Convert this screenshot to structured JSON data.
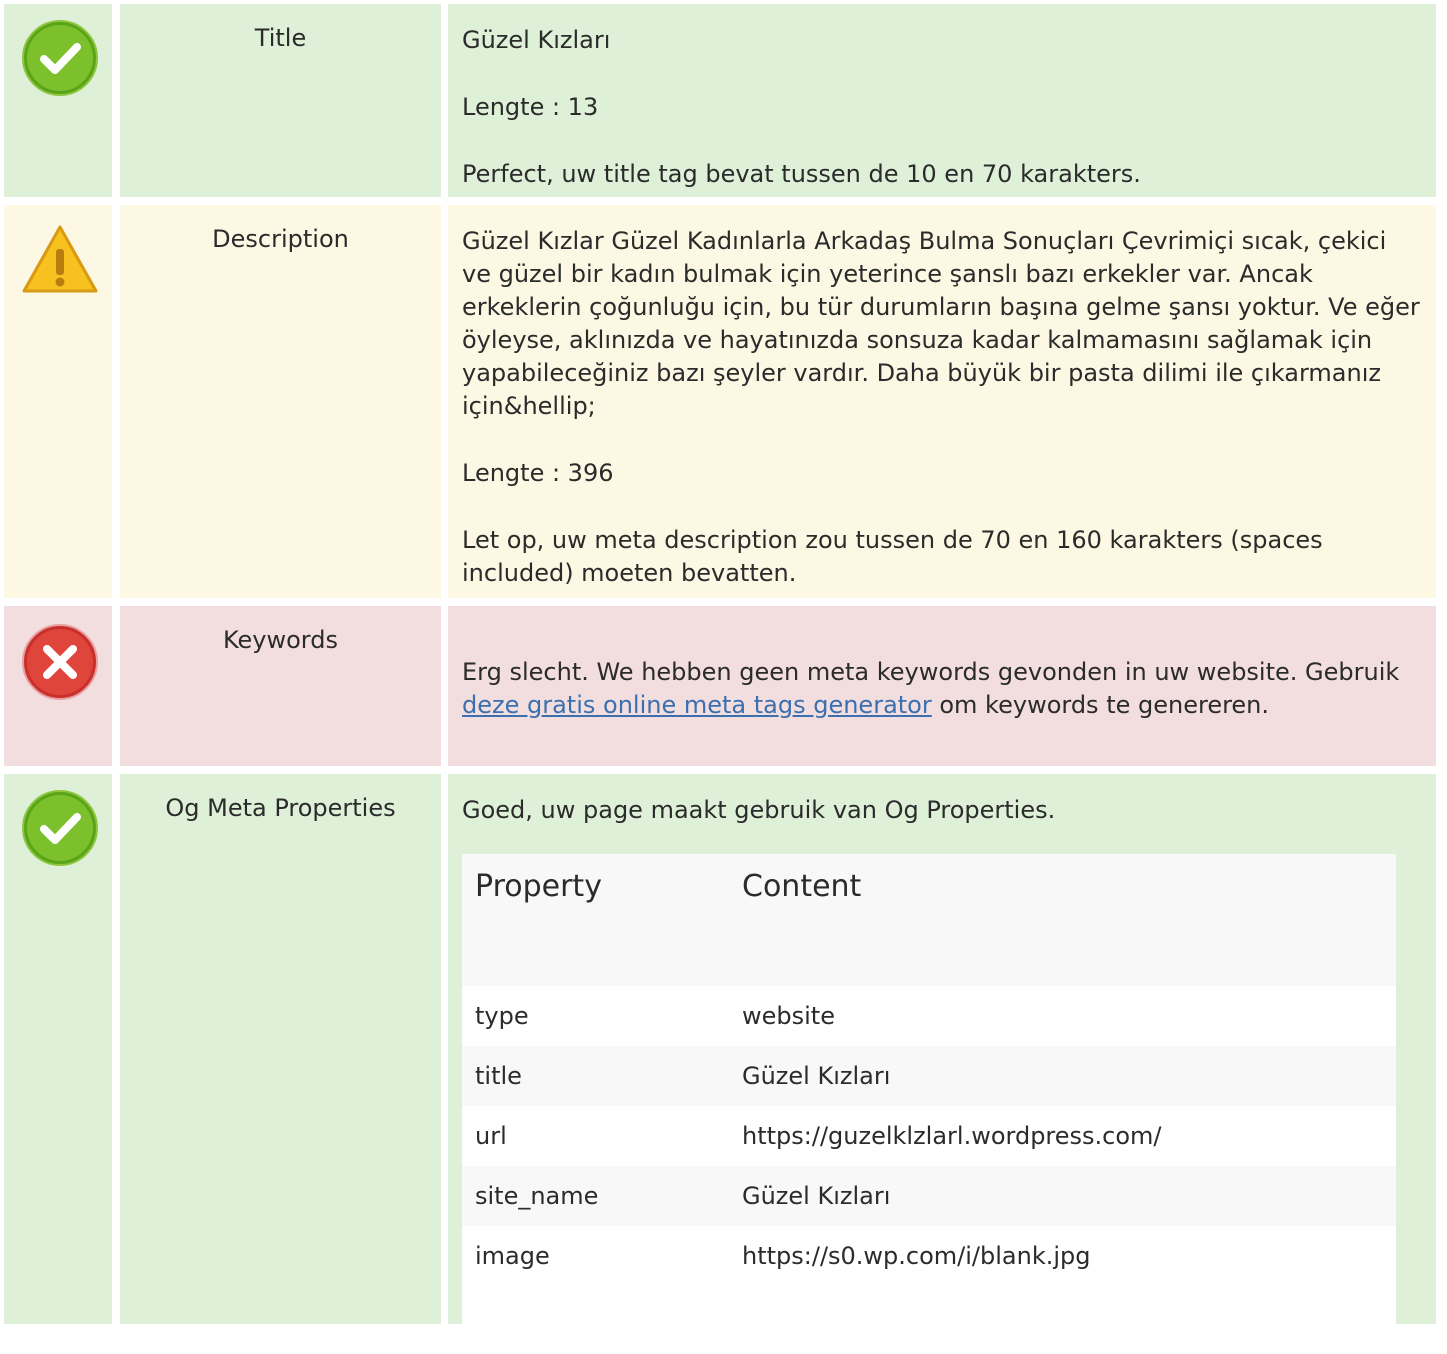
{
  "colors": {
    "success_bg": "#dff0d8",
    "warning_bg": "#fcf8e3",
    "danger_bg": "#f2dede",
    "link": "#3a6fb0"
  },
  "title_row": {
    "status_icon": "check-circle-icon",
    "label": "Title",
    "value": "Güzel Kızları",
    "length": "Lengte : 13",
    "message": "Perfect, uw title tag bevat tussen de 10 en 70 karakters."
  },
  "description_row": {
    "status_icon": "warning-triangle-icon",
    "label": "Description",
    "value": "Güzel Kızlar Güzel Kadınlarla Arkadaş Bulma Sonuçları Çevrimiçi sıcak, çekici ve güzel bir kadın bulmak için yeterince şanslı bazı erkekler var. Ancak erkeklerin çoğunluğu için, bu tür durumların başına gelme şansı yoktur. Ve eğer öyleyse, aklınızda ve hayatınızda sonsuza kadar kalmamasını sağlamak için yapabileceğiniz bazı şeyler vardır. Daha büyük bir pasta dilimi ile çıkarmanız için&hellip;",
    "length": "Lengte : 396",
    "message": "Let op, uw meta description zou tussen de 70 en 160 karakters (spaces included) moeten bevatten."
  },
  "keywords_row": {
    "status_icon": "error-circle-icon",
    "label": "Keywords",
    "message_before": "Erg slecht. We hebben geen meta keywords gevonden in uw website. Gebruik ",
    "link_text": "deze gratis online meta tags generator",
    "message_after": " om keywords te genereren."
  },
  "og_row": {
    "status_icon": "check-circle-icon",
    "label": "Og Meta Properties",
    "message": "Goed, uw page maakt gebruik van Og Properties.",
    "table": {
      "headers": [
        "Property",
        "Content"
      ],
      "rows": [
        [
          "type",
          "website"
        ],
        [
          "title",
          "Güzel Kızları"
        ],
        [
          "url",
          "https://guzelklzlarl.wordpress.com/"
        ],
        [
          "site_name",
          "Güzel Kızları"
        ],
        [
          "image",
          "https://s0.wp.com/i/blank.jpg"
        ]
      ]
    }
  }
}
